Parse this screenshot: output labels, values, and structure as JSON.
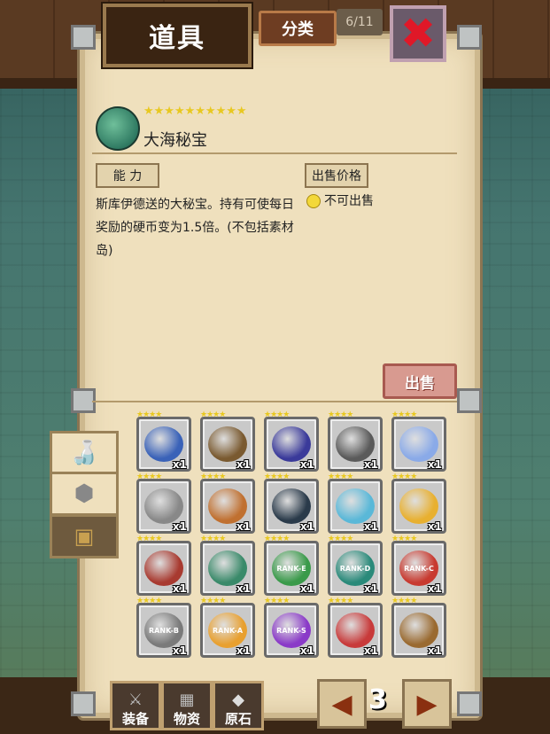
{
  "header": {
    "title": "道具",
    "category_button": "分类",
    "counter": "6/11"
  },
  "item": {
    "stars": "★★★★★★★★★★",
    "name": "大海秘宝"
  },
  "info": {
    "ability_label": "能 力",
    "price_label": "出售价格",
    "description": "斯库伊德送的大秘宝。持有可使每日奖励的硬币变为1.5倍。(不包括素材岛)",
    "sell_status": "不可出售",
    "sell_button": "出售"
  },
  "tabs": [
    {
      "name": "potion"
    },
    {
      "name": "ore"
    },
    {
      "name": "chest"
    }
  ],
  "grid": [
    {
      "color": "#3a62b8",
      "stars": "★★★★",
      "qty": "x1",
      "rank": ""
    },
    {
      "color": "#7a5a30",
      "stars": "★★★★",
      "qty": "x1",
      "rank": ""
    },
    {
      "color": "#3a3a9a",
      "stars": "★★★★",
      "qty": "x1",
      "rank": ""
    },
    {
      "color": "#5a5a5a",
      "stars": "★★★★",
      "qty": "x1",
      "rank": ""
    },
    {
      "color": "#8aaae8",
      "stars": "★★★★",
      "qty": "x1",
      "rank": ""
    },
    {
      "color": "#888888",
      "stars": "★★★★",
      "qty": "x1",
      "rank": ""
    },
    {
      "color": "#c07030",
      "stars": "★★★★",
      "qty": "x1",
      "rank": ""
    },
    {
      "color": "#2a3a4a",
      "stars": "★★★★",
      "qty": "x1",
      "rank": ""
    },
    {
      "color": "#5ab8d8",
      "stars": "★★★★",
      "qty": "x1",
      "rank": ""
    },
    {
      "color": "#e8b030",
      "stars": "★★★★",
      "qty": "x1",
      "rank": ""
    },
    {
      "color": "#a83a30",
      "stars": "★★★★",
      "qty": "x1",
      "rank": ""
    },
    {
      "color": "#3a8a6a",
      "stars": "★★★★",
      "qty": "x1",
      "rank": ""
    },
    {
      "color": "#3a9a4a",
      "stars": "★★★★",
      "qty": "x1",
      "rank": "RANK-E"
    },
    {
      "color": "#2a8a7a",
      "stars": "★★★★",
      "qty": "x1",
      "rank": "RANK-D"
    },
    {
      "color": "#c83a30",
      "stars": "★★★★",
      "qty": "x1",
      "rank": "RANK-C"
    },
    {
      "color": "#7a7a7a",
      "stars": "★★★★",
      "qty": "x1",
      "rank": "RANK-B"
    },
    {
      "color": "#e8a030",
      "stars": "★★★★",
      "qty": "x1",
      "rank": "RANK-A"
    },
    {
      "color": "#8a3ac8",
      "stars": "★★★★",
      "qty": "x1",
      "rank": "RANK-S"
    },
    {
      "color": "#c83a3a",
      "stars": "★★★★",
      "qty": "x1",
      "rank": ""
    },
    {
      "color": "#9a6a30",
      "stars": "★★★★",
      "qty": "x1",
      "rank": ""
    }
  ],
  "bottom_nav": {
    "equip": "装备",
    "materials": "物资",
    "stone": "原石",
    "page": "3"
  }
}
